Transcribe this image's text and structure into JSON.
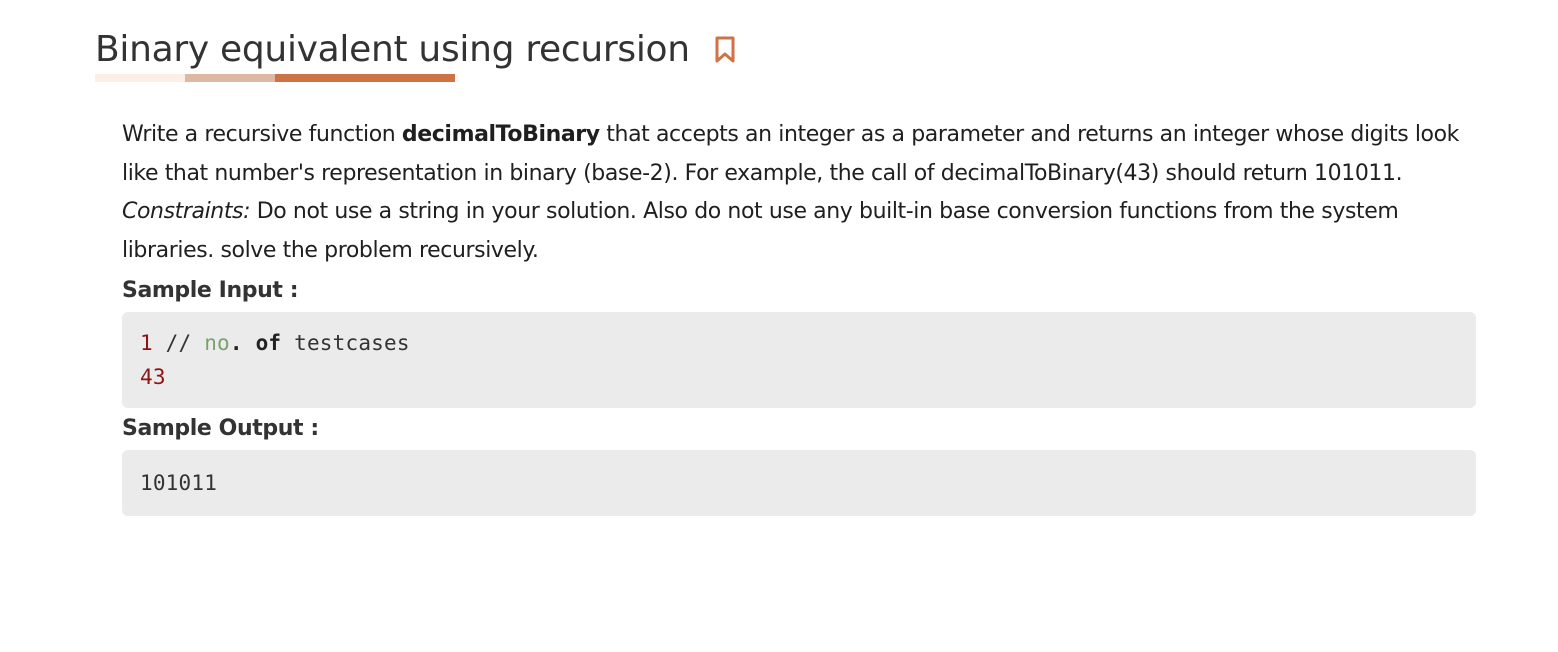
{
  "header": {
    "title": "Binary equivalent using recursion",
    "bookmark_icon": "bookmark-icon",
    "accent_colors": [
      "#fcefe6",
      "#dbb9a3",
      "#cf7346"
    ]
  },
  "problem": {
    "intro_before": "Write a recursive function ",
    "function_name": "decimalToBinary",
    "intro_after": " that accepts an integer as a parameter and returns an integer whose digits look like that number's representation in binary (base-2). For example, the call of decimalToBinary(43) should return 101011.",
    "constraints_label": "Constraints:",
    "constraints_text": " Do not use a string in your solution. Also do not use any built-in base conversion functions from the system libraries. solve the problem recursively."
  },
  "sample_input": {
    "label": "Sample Input :",
    "line1_number": "1",
    "line1_comment_slashes": " // ",
    "line1_no": "no",
    "line1_dot": ".",
    "line1_of": " of",
    "line1_rest": " testcases",
    "line2": "43"
  },
  "sample_output": {
    "label": "Sample Output :",
    "value": "101011"
  }
}
